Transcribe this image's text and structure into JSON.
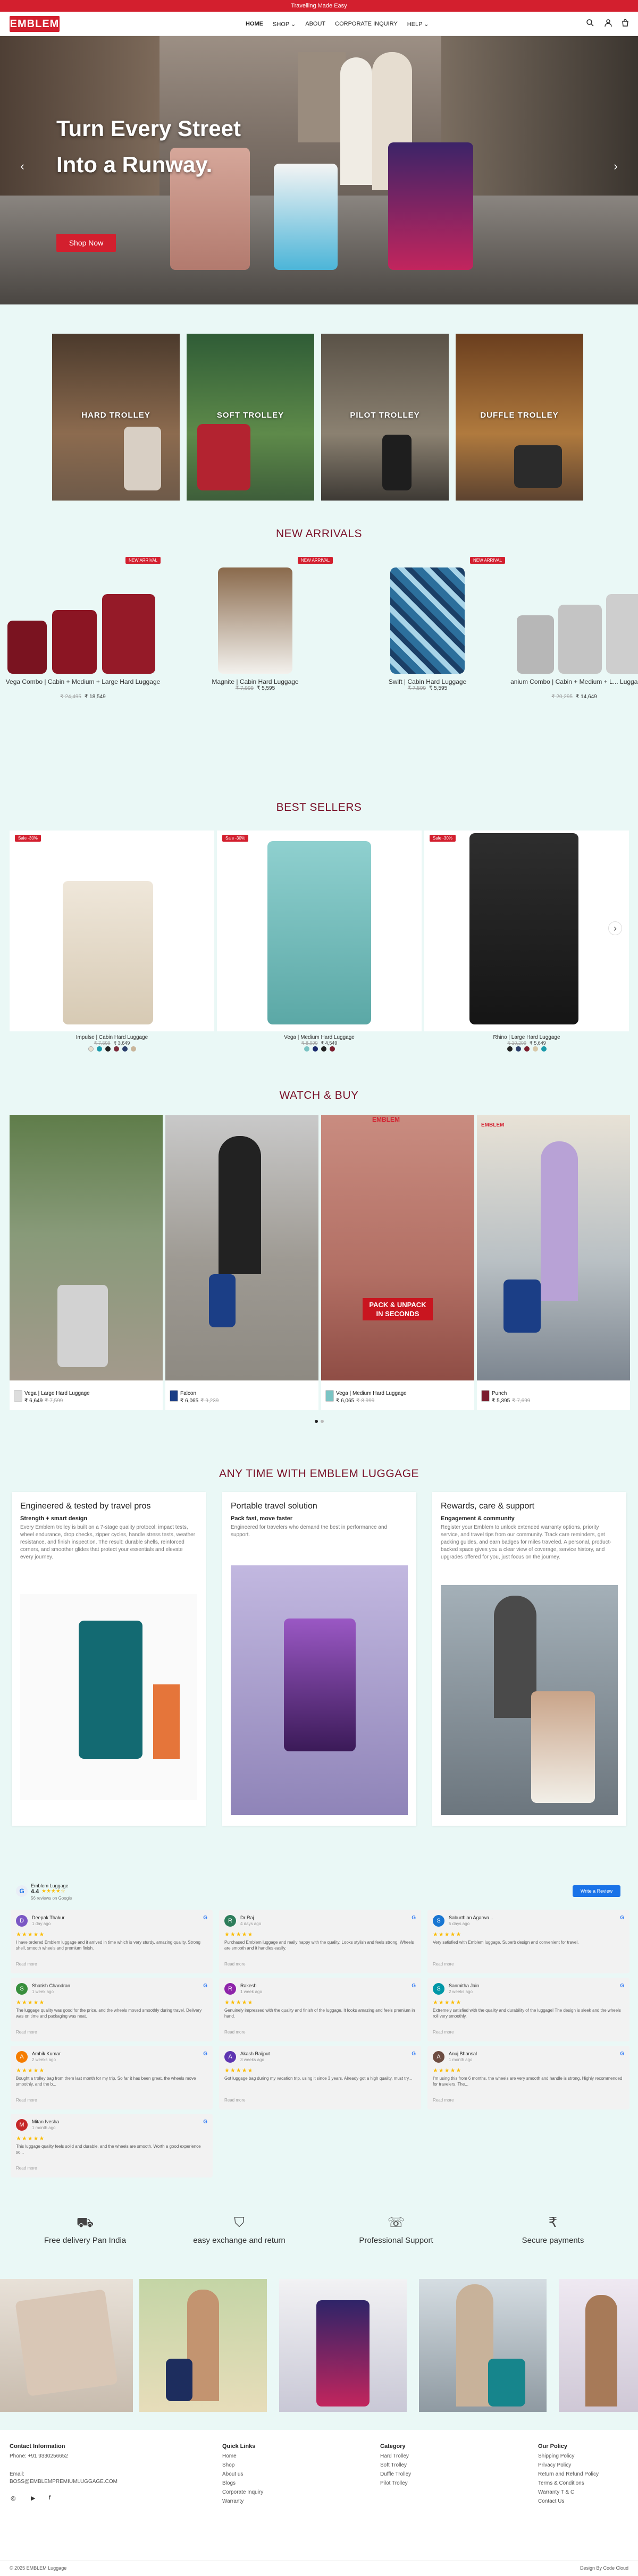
{
  "announcement": "Travelling Made Easy",
  "header": {
    "logo": "EMBLEM",
    "nav": [
      "HOME",
      "SHOP ⌄",
      "ABOUT",
      "CORPORATE INQUIRY",
      "HELP ⌄"
    ],
    "icons": [
      "search-icon",
      "account-icon",
      "cart-icon"
    ]
  },
  "hero": {
    "line1": "Turn Every Street",
    "line2": "Into a Runway.",
    "button": "Shop Now",
    "prev": "‹",
    "next": "›"
  },
  "categories": [
    {
      "label": "HARD TROLLEY"
    },
    {
      "label": "SOFT TROLLEY"
    },
    {
      "label": "PILOT TROLLEY"
    },
    {
      "label": "DUFFLE TROLLEY"
    }
  ],
  "new_arrivals": {
    "title": "NEW ARRIVALS",
    "products": [
      {
        "name": "Vega Combo | Cabin + Medium + Large Hard Luggage",
        "old": "₹ 24,495",
        "price": "₹ 18,549",
        "badge": "NEW ARRIVAL"
      },
      {
        "name": "Magnite | Cabin Hard Luggage",
        "old": "₹ 7,999",
        "price": "₹ 5,595",
        "badge": "NEW ARRIVAL"
      },
      {
        "name": "Swift | Cabin Hard Luggage",
        "old": "₹ 7,599",
        "price": "₹ 5,595",
        "badge": "NEW ARRIVAL"
      },
      {
        "name": "Titanium Combo | Cabin + Medium + L... Luggage",
        "old": "₹ 20,295",
        "price": "₹ 14,649",
        "badge": "NEW ARRIVAL"
      }
    ]
  },
  "best_sellers": {
    "title": "BEST SELLERS",
    "next": "›",
    "products": [
      {
        "name": "Impulse | Cabin Hard Luggage",
        "old": "₹ 7,599",
        "price": "₹ 3,649",
        "badge": "Sale -30%",
        "colors": [
          "#e8e0d0",
          "#1b9aaa",
          "#222",
          "#7b2b3b",
          "#2b3e6b",
          "#c9b59a"
        ]
      },
      {
        "name": "Vega | Medium Hard Luggage",
        "old": "₹ 8,999",
        "price": "₹ 4,549",
        "badge": "Sale -30%",
        "colors": [
          "#7bc4c4",
          "#1a2a6c",
          "#222",
          "#7b1d2e"
        ]
      },
      {
        "name": "Rhino | Large Hard Luggage",
        "old": "₹ 10,299",
        "price": "₹ 5,649",
        "badge": "Sale -30%",
        "colors": [
          "#222",
          "#2b3e6b",
          "#7b1d2e",
          "#d8c8a8",
          "#1b9aaa"
        ]
      }
    ]
  },
  "watch_buy": {
    "title": "WATCH & BUY",
    "overlay": [
      "PACK & UNPACK",
      "IN SECONDS"
    ],
    "overlay_logo": "EMBLEM",
    "items": [
      {
        "name": "Vega | Large Hard Luggage",
        "price": "₹ 6,649",
        "old": "₹ 7,599"
      },
      {
        "name": "Falcon",
        "price": "₹ 6,065",
        "old": "₹ 9,239"
      },
      {
        "name": "Vega | Medium Hard Luggage",
        "price": "₹ 6,065",
        "old": "₹ 8,999"
      },
      {
        "name": "Punch",
        "price": "₹ 5,395",
        "old": "₹ 7,699"
      }
    ]
  },
  "any_time": {
    "title": "ANY TIME WITH EMBLEM LUGGAGE",
    "cards": [
      {
        "heading": "Engineered & tested by travel pros",
        "sub": "Strength + smart design",
        "text": "Every Emblem trolley is built on a 7-stage quality protocol: impact tests, wheel endurance, drop checks, zipper cycles, handle stress tests, weather resistance, and finish inspection. The result: durable shells, reinforced corners, and smoother glides that protect your essentials and elevate every journey."
      },
      {
        "heading": "Portable travel solution",
        "sub": "Pack fast, move faster",
        "text": "Engineered for travelers who demand the best in performance and support."
      },
      {
        "heading": "Rewards, care & support",
        "sub": "Engagement & community",
        "text": "Register your Emblem to unlock extended warranty options, priority service, and travel tips from our community. Track care reminders, get packing guides, and earn badges for miles traveled. A personal, product-backed space gives you a clear view of coverage, service history, and upgrades offered for you, just focus on the journey."
      }
    ]
  },
  "reviews": {
    "brand": "Emblem Luggage",
    "rating": "4.4",
    "stars": "★★★★☆",
    "count": "56 reviews on Google",
    "write": "Write a Review",
    "stars_full": "★★★★★",
    "more": "Read more",
    "items": [
      {
        "name": "Deepak Thakur",
        "date": "1 day ago",
        "initial": "D",
        "color": "#7b57c4",
        "text": "I have ordered Emblem luggage and it arrived in time which is very sturdy, amazing quality. Strong shell, smooth wheels and premium finish."
      },
      {
        "name": "Dr Raj",
        "date": "4 days ago",
        "initial": "R",
        "color": "#2e7d5b",
        "text": "Purchased Emblem luggage and really happy with the quality. Looks stylish and feels strong. Wheels are smooth and it handles easily."
      },
      {
        "name": "Saburthian Agarwa...",
        "date": "5 days ago",
        "initial": "S",
        "color": "#1976d2",
        "text": "Very satisfied with Emblem luggage. Superb design and convenient for travel."
      },
      {
        "name": "Shatish Chandran",
        "date": "1 week ago",
        "initial": "S",
        "color": "#388e3c",
        "text": "The luggage quality was good for the price, and the wheels moved smoothly during travel. Delivery was on time and packaging was neat."
      },
      {
        "name": "Rakesh",
        "date": "1 week ago",
        "initial": "R",
        "color": "#8e24aa",
        "text": "Genuinely impressed with the quality and finish of the luggage. It looks amazing and feels premium in hand."
      },
      {
        "name": "Sanmitha Jain",
        "date": "2 weeks ago",
        "initial": "S",
        "color": "#0097a7",
        "text": "Extremely satisfied with the quality and durability of the luggage! The design is sleek and the wheels roll very smoothly."
      },
      {
        "name": "Ambik Kumar",
        "date": "2 weeks ago",
        "initial": "A",
        "color": "#f57c00",
        "text": "Bought a trolley bag from them last month for my trip. So far it has been great, the wheels move smoothly, and the b..."
      },
      {
        "name": "Akash Raijput",
        "date": "3 weeks ago",
        "initial": "A",
        "color": "#5e35b1",
        "text": "Got luggage bag during my vacation trip, using it since 3 years. Already got a high quality, must try..."
      },
      {
        "name": "Anuj Bhansal",
        "date": "1 month ago",
        "initial": "A",
        "color": "#6d4c41",
        "text": "I'm using this from 6 months, the wheels are very smooth and handle is strong. Highly recommended for travelers. The..."
      },
      {
        "name": "Mitan Ivesha",
        "date": "1 month ago",
        "initial": "M",
        "color": "#c62828",
        "text": "This luggage quality feels solid and durable, and the wheels are smooth. Worth a good experience so..."
      }
    ]
  },
  "features": [
    {
      "icon": "truck-icon",
      "glyph": "⛟",
      "label": "Free delivery Pan India"
    },
    {
      "icon": "bag-icon",
      "glyph": "⛉",
      "label": "easy exchange and return"
    },
    {
      "icon": "support-icon",
      "glyph": "☏",
      "label": "Professional Support"
    },
    {
      "icon": "payment-icon",
      "glyph": "₹",
      "label": "Secure payments"
    }
  ],
  "footer": {
    "contact_title": "Contact Information",
    "phone": "Phone: +91 9330256652",
    "email_label": "Email:",
    "email": "BOSS@EMBLEMPREMIUMLUGGAGE.COM",
    "quick_title": "Quick Links",
    "quick": [
      "Home",
      "Shop",
      "About us",
      "Blogs",
      "Corporate Inquiry",
      "Warranty"
    ],
    "cat_title": "Category",
    "cats": [
      "Hard Trolley",
      "Soft Trolley",
      "Duffle Trolley",
      "Pilot Trolley"
    ],
    "policy_title": "Our Policy",
    "policies": [
      "Shipping Policy",
      "Privacy Policy",
      "Return and Refund Policy",
      "Terms & Conditions",
      "Warranty T & C",
      "Contact Us"
    ],
    "copyright": "© 2025 EMBLEM Luggage",
    "credit": "Design By Code Cloud"
  },
  "colors": {
    "brand": "#d31f2e",
    "title": "#7a1028",
    "background": "#eaf8f6"
  }
}
